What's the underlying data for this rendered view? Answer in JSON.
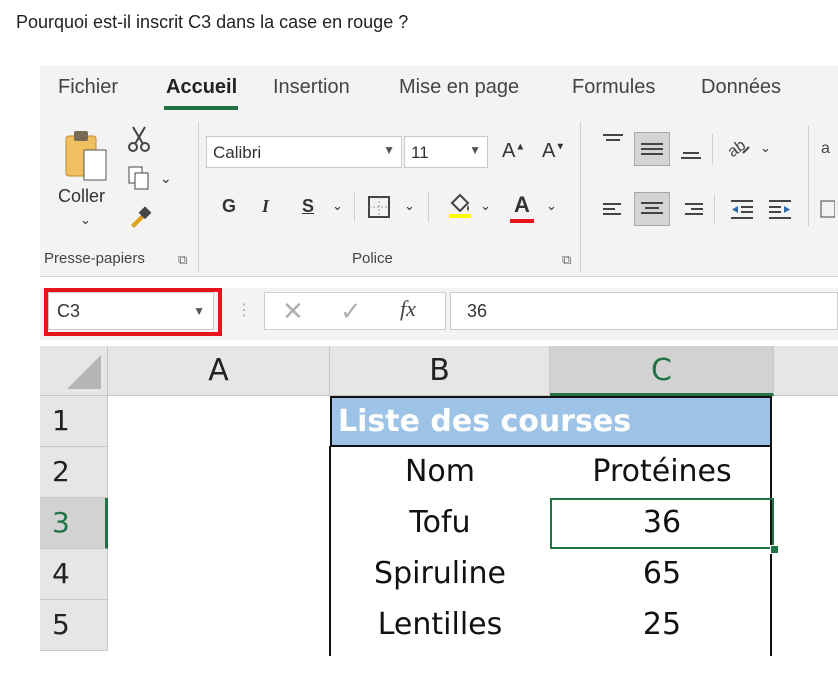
{
  "question": "Pourquoi est-il inscrit C3 dans la case en rouge ?",
  "tabs": [
    "Fichier",
    "Accueil",
    "Insertion",
    "Mise en page",
    "Formules",
    "Données"
  ],
  "ribbon": {
    "clipboard": {
      "paste_label": "Coller",
      "group_label": "Presse-papiers"
    },
    "font": {
      "font_name": "Calibri",
      "font_size": "11",
      "bold": "G",
      "italic": "I",
      "underline": "S",
      "font_color_letter": "A",
      "grow_font": "A",
      "shrink_font": "A",
      "group_label": "Police"
    }
  },
  "formula_bar": {
    "name_box": "C3",
    "fx_label": "fx",
    "value": "36"
  },
  "grid": {
    "columns": [
      "A",
      "B",
      "C"
    ],
    "selected_column": "C",
    "rows": [
      "1",
      "2",
      "3",
      "4",
      "5"
    ],
    "selected_row": "3",
    "title": "Liste des courses",
    "header": [
      "Nom",
      "Protéines"
    ],
    "data": [
      [
        "Tofu",
        "36"
      ],
      [
        "Spiruline",
        "65"
      ],
      [
        "Lentilles",
        "25"
      ]
    ]
  },
  "colors": {
    "accent": "#217346",
    "highlight": "#e3141b",
    "title_fill": "#9dc3e6"
  }
}
